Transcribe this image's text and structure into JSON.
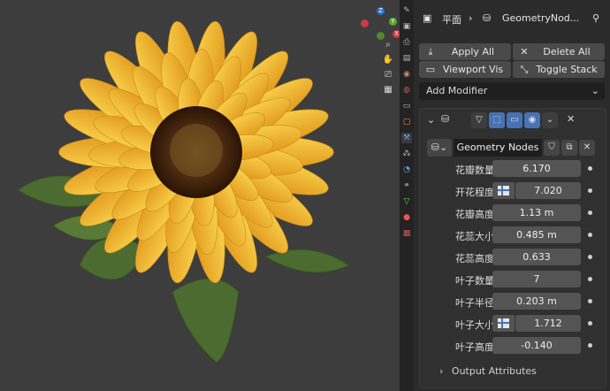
{
  "header": {
    "breadcrumb_object": "平面",
    "breadcrumb_modifier": "GeometryNod..."
  },
  "toolbar": {
    "apply_all": "Apply All",
    "delete_all": "Delete All",
    "viewport_vis": "Viewport Vis",
    "toggle_stack": "Toggle Stack"
  },
  "add_modifier": "Add Modifier",
  "modifier": {
    "node_group": "Geometry Nodes",
    "inputs": [
      {
        "label": "花瓣数量",
        "value": "6.170",
        "texture": false
      },
      {
        "label": "开花程度",
        "value": "7.020",
        "texture": true
      },
      {
        "label": "花瓣高度",
        "value": "1.13 m",
        "texture": false
      },
      {
        "label": "花蕊大小",
        "value": "0.485 m",
        "texture": false
      },
      {
        "label": "花蕊高度",
        "value": "0.633",
        "texture": false
      },
      {
        "label": "叶子数量",
        "value": "7",
        "texture": false
      },
      {
        "label": "叶子半径",
        "value": "0.203 m",
        "texture": false
      },
      {
        "label": "叶子大小",
        "value": "1.712",
        "texture": true
      },
      {
        "label": "叶子高度",
        "value": "-0.140",
        "texture": false
      }
    ],
    "output_attributes": "Output Attributes"
  },
  "gizmo": {
    "z_label": "Z",
    "y_label": "Y",
    "x_label": "X"
  },
  "colors": {
    "accent_blue": "#4772b3",
    "petal": "#f2b632",
    "center": "#3b1f0e",
    "leaf": "#4a6b2e"
  }
}
